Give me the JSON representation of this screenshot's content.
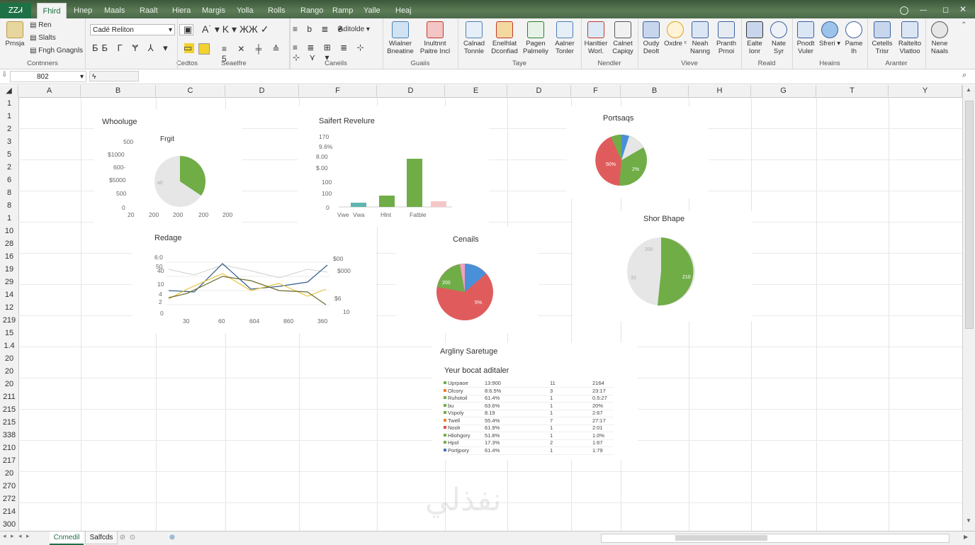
{
  "window": {
    "file_tab": "ᏃᏃᏗ",
    "active_tab": "Fhird",
    "tabs": [
      "Hnep",
      "Maals",
      "Raalt",
      "Hiera",
      "Margis",
      "Yolla",
      "Rolls",
      "Rango",
      "Ramp",
      "Yalle",
      "Heaj"
    ],
    "watermark": "نفذلي"
  },
  "ribbon": {
    "clipboard": {
      "paste_label": "Prnsja",
      "items": [
        "Ren",
        "Slalts",
        "Fngh Gnagnls"
      ],
      "group_label": "Contnners"
    },
    "font": {
      "font_name": "Cadé Reliton",
      "font_size": "",
      "group_label": "Cedtos"
    },
    "alignment": {
      "group_label": "Seaelfre"
    },
    "number": {
      "format": "Aditolde",
      "group_label": "Caneils"
    },
    "styles": {
      "buttons": [
        "Wialner Bneatine",
        "Inultnnt Paitre Incl"
      ],
      "group_label": "Guaiis"
    },
    "cells": {
      "buttons": [
        "Calnad Tonnle",
        "Enelhlat Dconfiad",
        "Pagen Palmeliy",
        "Aalner Tonler"
      ],
      "group_label": "Taye"
    },
    "editing": {
      "buttons": [
        "Hanltier Worl.",
        "Calnet Capiqy"
      ],
      "group_label": "Nendler"
    },
    "view": {
      "buttons": [
        "Oudy Deolt",
        "Oxdre ᶜ",
        "Neah Nanng",
        "Pranth Prnoi"
      ],
      "group_label": "Vieve"
    },
    "review": {
      "buttons": [
        "Ealte Ionr",
        "Nate Syr"
      ],
      "group_label": "Reald"
    },
    "insert": {
      "buttons": [
        "Pnodt Vuler",
        "Sfreri ▾",
        "Pame Ih"
      ],
      "group_label": "Heains"
    },
    "arrange": {
      "buttons": [
        "Cetells Trisr",
        "Raltelto Vlatloo"
      ],
      "group_label": "Aranter"
    },
    "extra": {
      "buttons": [
        "Nene Naals"
      ]
    }
  },
  "formula_bar": {
    "name_box": "802",
    "fx": "ϟ",
    "formula": ""
  },
  "columns": [
    "A",
    "B",
    "C",
    "D",
    "F",
    "D",
    "E",
    "D",
    "F",
    "B",
    "H",
    "G",
    "T",
    "Y"
  ],
  "rows": [
    "1",
    "1",
    "2",
    "3",
    "5",
    "2",
    "6",
    "8",
    "8",
    "1",
    "10",
    "28",
    "16",
    "19",
    "29",
    "14",
    "12",
    "219",
    "15",
    "1.4",
    "20",
    "20",
    "20",
    "211",
    "215",
    "215",
    "338",
    "210",
    "217",
    "20",
    "270",
    "272",
    "214",
    "300"
  ],
  "charts": {
    "pie1": {
      "title": "Whooluge",
      "subtitle": "Frgit",
      "y_ticks": [
        "500",
        "$1000",
        "600-",
        "$5000",
        "500",
        "0"
      ],
      "x_ticks": [
        "20",
        "200",
        "200",
        "200",
        "200"
      ],
      "slice_label": "a0"
    },
    "bar": {
      "title": "Saifert Revelure",
      "y_ticks": [
        "170",
        "9.6%",
        "8.00",
        "$.00",
        "100",
        "100",
        "0"
      ],
      "x_labels": [
        "Vwe",
        "Vwa",
        "Hlnt",
        "Fatble"
      ]
    },
    "pie2": {
      "title": "Portsaqs",
      "labels": [
        "50%",
        "2%"
      ]
    },
    "line": {
      "title": "Redage",
      "y_ticks": [
        "6:0",
        "50",
        "40",
        "10",
        "4",
        "2",
        "0"
      ],
      "y2_ticks": [
        "$00",
        "$000",
        "$6",
        "10"
      ],
      "x_ticks": [
        "30",
        "60",
        "604",
        "860",
        "360"
      ]
    },
    "pie3": {
      "title": "Cenails",
      "labels": [
        "200",
        "5%"
      ]
    },
    "pie4": {
      "title": "Shor Bhape",
      "labels": [
        "200",
        "33",
        "210"
      ]
    }
  },
  "table": {
    "section_title": "Argliny Saretuge",
    "subtitle": "Yeur bocat aditaler",
    "rows": [
      {
        "name": "Uprpaoe",
        "v1": "13:900",
        "v2": "11",
        "v3": "2164",
        "color": "#70ad47"
      },
      {
        "name": "Olcory",
        "v1": "8:6.5%",
        "v2": "3",
        "v3": "23:17",
        "color": "#ed7d31"
      },
      {
        "name": "Ruhotoil",
        "v1": "61.4%",
        "v2": "1",
        "v3": "0.5:27",
        "color": "#70ad47"
      },
      {
        "name": "bu",
        "v1": "63.6%",
        "v2": "1",
        "v3": "20%",
        "color": "#70ad47"
      },
      {
        "name": "Vspoly",
        "v1": "8.19",
        "v2": "1",
        "v3": "2:67",
        "color": "#70ad47"
      },
      {
        "name": "Twell",
        "v1": "55.4%",
        "v2": "7",
        "v3": "27:17",
        "color": "#ed7d31"
      },
      {
        "name": "Noolr",
        "v1": "61.9%",
        "v2": "1",
        "v3": "2:01",
        "color": "#e05050"
      },
      {
        "name": "Hliohgory",
        "v1": "51.8%",
        "v2": "1",
        "v3": "1.0%",
        "color": "#70ad47"
      },
      {
        "name": "Hpol",
        "v1": "17.3%",
        "v2": "2",
        "v3": "1:67",
        "color": "#70ad47"
      },
      {
        "name": "Portjpory",
        "v1": "61.4%",
        "v2": "1",
        "v3": "1:79",
        "color": "#4472c4"
      }
    ]
  },
  "sheets": {
    "tabs": [
      "Cnmedil",
      "Salfcds"
    ],
    "icons": [
      "⊘",
      "⊙",
      "⊕"
    ]
  },
  "colors": {
    "green": "#70ad47",
    "red": "#e05c5c",
    "blue": "#4a90d9",
    "teal": "#5fb5b0",
    "grey": "#e6e6e6",
    "yellow": "#e8c23a",
    "navy": "#2f5c8a",
    "olive": "#6b6b2a"
  }
}
